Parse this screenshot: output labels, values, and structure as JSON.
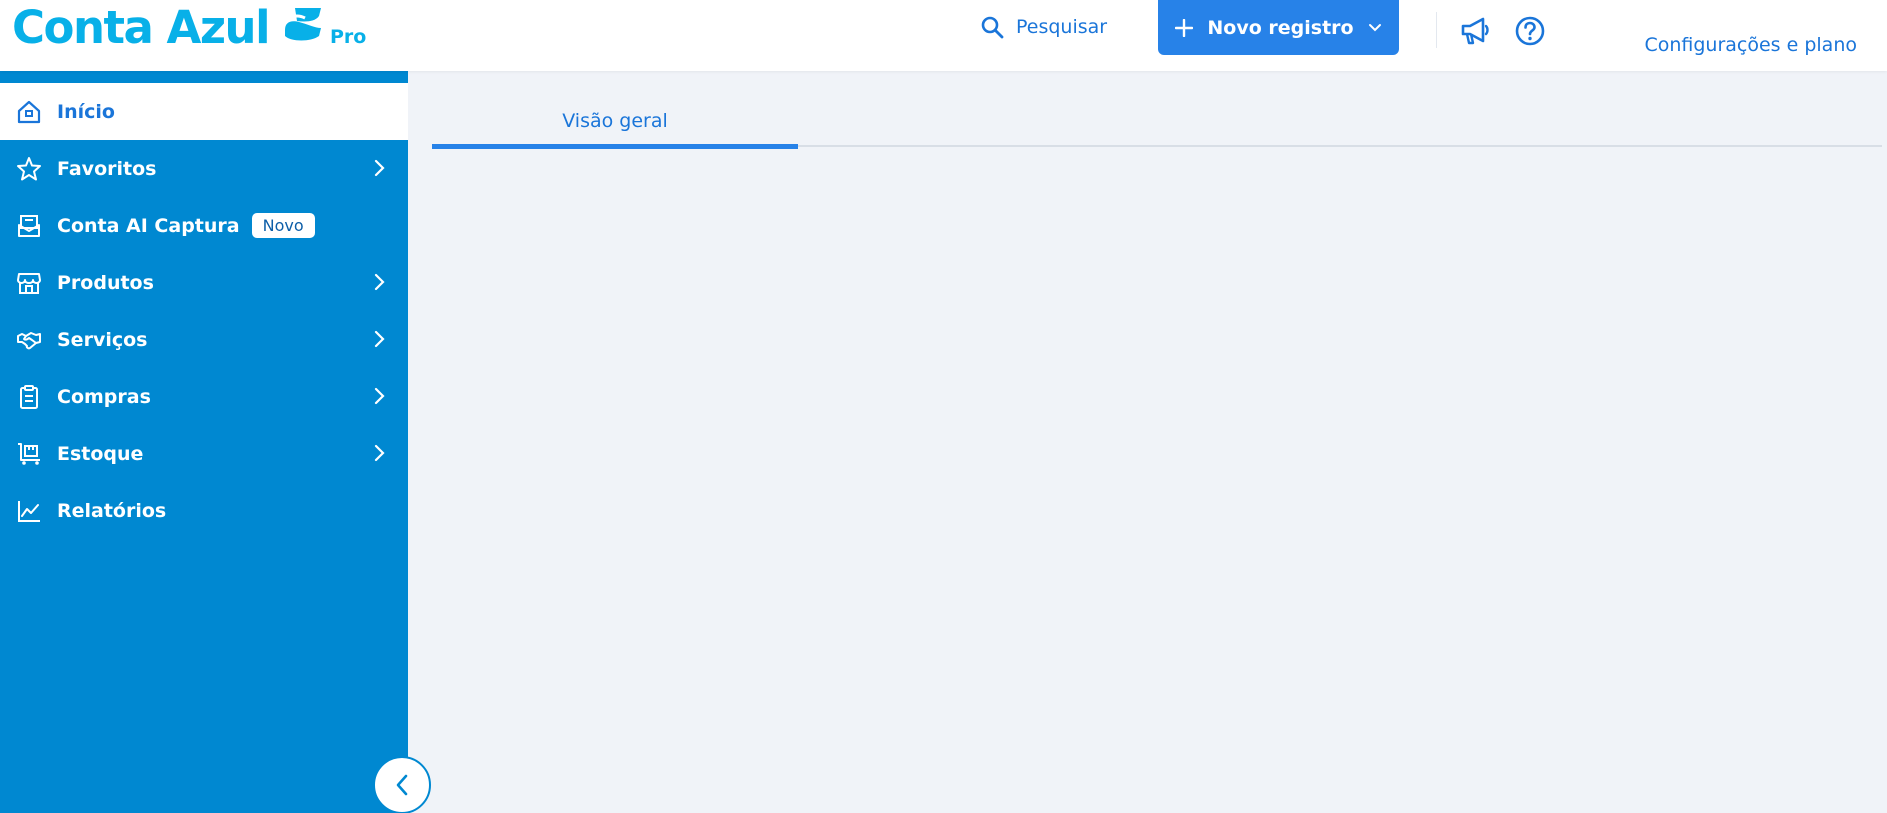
{
  "brand": {
    "logo_text": "Conta Azul",
    "plan": "Pro",
    "color": "#08b0e8"
  },
  "header": {
    "search_label": "Pesquisar",
    "new_record_label": "Novo registro",
    "settings_label": "Configurações e plano",
    "accent": "#2782e8"
  },
  "sidebar": {
    "background": "#0088d1",
    "items": [
      {
        "label": "Início",
        "icon": "home-icon",
        "active": true
      },
      {
        "label": "Favoritos",
        "icon": "star-icon",
        "has_submenu": true
      },
      {
        "label": "Conta AI Captura",
        "icon": "inbox-icon",
        "badge": "Novo"
      },
      {
        "label": "Produtos",
        "icon": "store-icon",
        "has_submenu": true
      },
      {
        "label": "Serviços",
        "icon": "handshake-icon",
        "has_submenu": true
      },
      {
        "label": "Compras",
        "icon": "clipboard-icon",
        "has_submenu": true
      },
      {
        "label": "Estoque",
        "icon": "inventory-icon",
        "has_submenu": true
      },
      {
        "label": "Relatórios",
        "icon": "chart-line-icon"
      }
    ]
  },
  "main": {
    "tabs": [
      {
        "label": "Visão geral",
        "active": true
      }
    ]
  }
}
